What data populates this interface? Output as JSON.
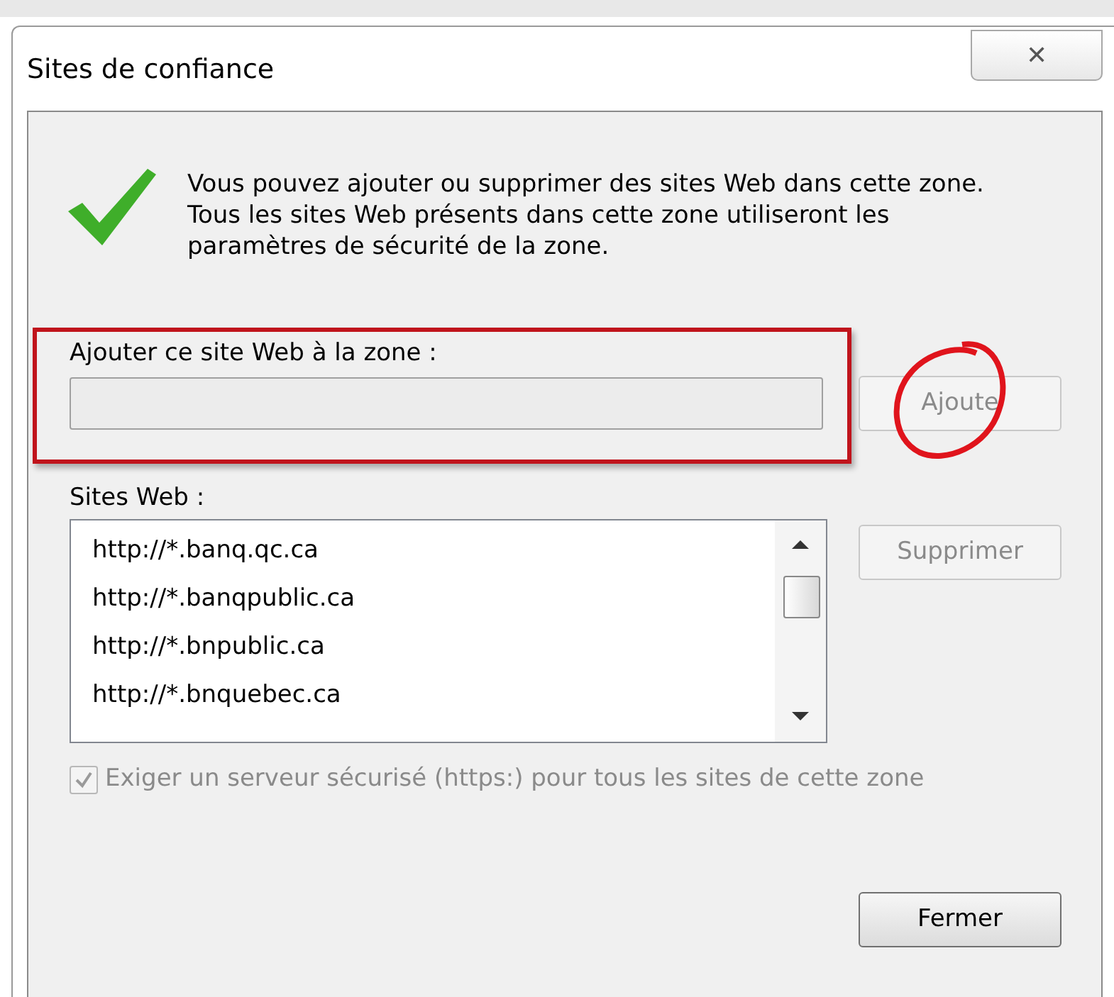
{
  "window": {
    "title": "Sites de confiance",
    "close": "✕"
  },
  "message": "Vous pouvez ajouter ou supprimer des sites Web dans cette zone. Tous les sites Web présents dans cette zone utiliseront les paramètres de sécurité de la zone.",
  "add_field": {
    "label": "Ajouter ce site Web à la zone :"
  },
  "add_button": {
    "label": "Ajoute",
    "disabled": true
  },
  "sites_label": "Sites Web :",
  "sites": [
    {
      "url": "http://*.banq.qc.ca",
      "selected": false
    },
    {
      "url": "http://*.banqpublic.ca",
      "selected": false
    },
    {
      "url": "http://*.bnpublic.ca",
      "selected": false
    },
    {
      "url": "http://*.bnquebec.ca",
      "selected": false
    }
  ],
  "remove_button": {
    "label": "Supprimer",
    "disabled": true
  },
  "require_https": {
    "label": "Exiger un serveur sécurisé (https:) pour tous les sites de cette zone",
    "checked": true,
    "disabled": true
  },
  "close_button": {
    "label": "Fermer",
    "disabled": false
  }
}
